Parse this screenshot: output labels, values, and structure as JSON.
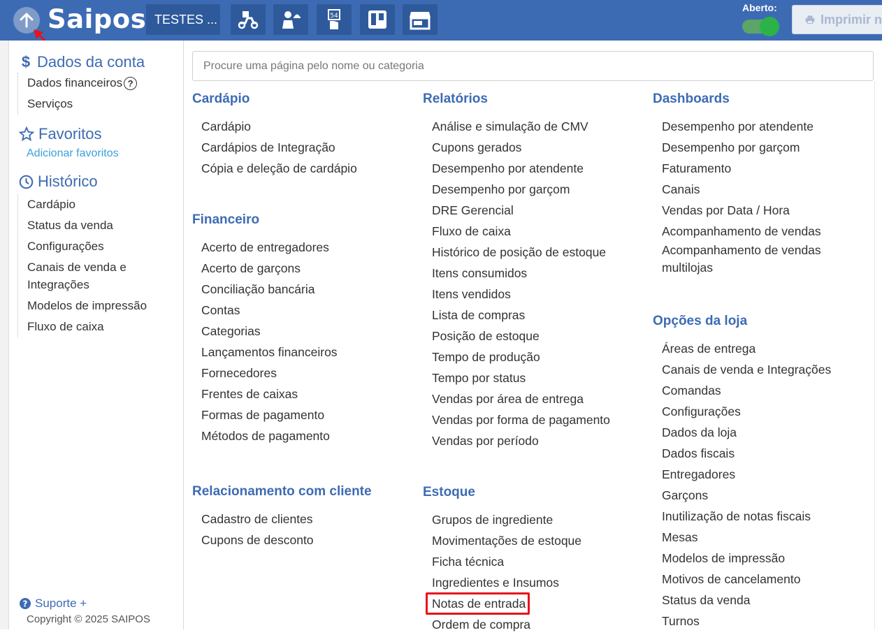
{
  "topbar": {
    "logo": "Saipos",
    "store_name": "TESTES ...",
    "icons": [
      "delivery-scooter-icon",
      "waiter-icon",
      "table-number-icon",
      "kanban-board-icon",
      "storefront-icon"
    ],
    "status_label": "Aberto:",
    "status_on": true,
    "print_label": "Imprimir ne"
  },
  "sidebar": {
    "account_title": "Dados da conta",
    "account_items": [
      "Dados financeiros",
      "Serviços"
    ],
    "favorites_title": "Favoritos",
    "favorites_link": "Adicionar favoritos",
    "history_title": "Histórico",
    "history_items": [
      "Cardápio",
      "Status da venda",
      "Configurações",
      "Canais de venda e Integrações",
      "Modelos de impressão",
      "Fluxo de caixa"
    ],
    "support_label": "Suporte +",
    "copyright": "Copyright © 2025 SAIPOS"
  },
  "search": {
    "placeholder": "Procure uma página pelo nome ou categoria"
  },
  "categories": {
    "cardapio": {
      "title": "Cardápio",
      "items": [
        "Cardápio",
        "Cardápios de Integração",
        "Cópia e deleção de cardápio"
      ]
    },
    "financeiro": {
      "title": "Financeiro",
      "items": [
        "Acerto de entregadores",
        "Acerto de garçons",
        "Conciliação bancária",
        "Contas",
        "Categorias",
        "Lançamentos financeiros",
        "Fornecedores",
        "Frentes de caixas",
        "Formas de pagamento",
        "Métodos de pagamento"
      ]
    },
    "relacionamento": {
      "title": "Relacionamento com cliente",
      "items": [
        "Cadastro de clientes",
        "Cupons de desconto"
      ]
    },
    "relatorios": {
      "title": "Relatórios",
      "items": [
        "Análise e simulação de CMV",
        "Cupons gerados",
        "Desempenho por atendente",
        "Desempenho por garçom",
        "DRE Gerencial",
        "Fluxo de caixa",
        "Histórico de posição de estoque",
        "Itens consumidos",
        "Itens vendidos",
        "Lista de compras",
        "Posição de estoque",
        "Tempo de produção",
        "Tempo por status",
        "Vendas por área de entrega",
        "Vendas por forma de pagamento",
        "Vendas por período"
      ]
    },
    "estoque": {
      "title": "Estoque",
      "items": [
        "Grupos de ingrediente",
        "Movimentações de estoque",
        "Ficha técnica",
        "Ingredientes e Insumos",
        "Notas de entrada",
        "Ordem de compra"
      ]
    },
    "dashboards": {
      "title": "Dashboards",
      "items": [
        "Desempenho por atendente",
        "Desempenho por garçom",
        "Faturamento",
        "Canais",
        "Vendas por Data / Hora",
        "Acompanhamento de vendas",
        "Acompanhamento de vendas multilojas"
      ]
    },
    "opcoes_loja": {
      "title": "Opções da loja",
      "items": [
        "Áreas de entrega",
        "Canais de venda e Integrações",
        "Comandas",
        "Configurações",
        "Dados da loja",
        "Dados fiscais",
        "Entregadores",
        "Garçons",
        "Inutilização de notas fiscais",
        "Mesas",
        "Modelos de impressão",
        "Motivos de cancelamento",
        "Status da venda",
        "Turnos"
      ]
    }
  },
  "colors": {
    "brand": "#3d6bb3",
    "highlight": "#e8131b",
    "toggle_on": "#2bb34a",
    "annotation_arrow": "#e8131b"
  }
}
